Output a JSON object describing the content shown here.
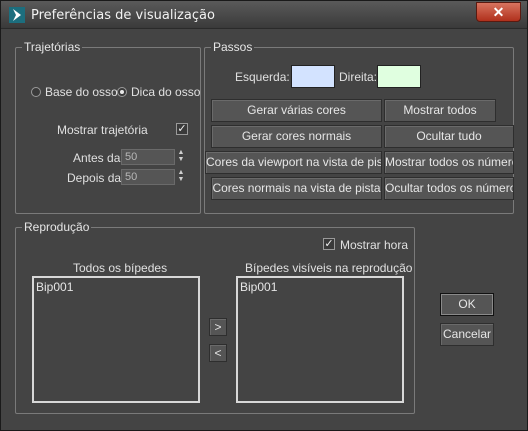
{
  "window": {
    "title": "Preferências de visualização",
    "close_label": "✕"
  },
  "trajetorias": {
    "title": "Trajetórias",
    "radio_base": "Base do osso",
    "radio_dica": "Dica do osso",
    "mostrar_trajetoria": "Mostrar trajetória",
    "antes_label": "Antes da",
    "antes_value": "50",
    "depois_label": "Depois da",
    "depois_value": "50"
  },
  "passos": {
    "title": "Passos",
    "esquerda_label": "Esquerda:",
    "direita_label": "Direita:",
    "colors": {
      "esquerda": "#d3e3ff",
      "direita": "#e0ffe0"
    },
    "buttons": {
      "gerar_varias": "Gerar várias cores",
      "mostrar_todos": "Mostrar todos",
      "gerar_normais": "Gerar cores normais",
      "ocultar_tudo": "Ocultar tudo",
      "cores_viewport": "Cores da viewport na vista de pista",
      "mostrar_numeros": "Mostrar todos os números",
      "cores_normais_pista": "Cores normais na vista de pista",
      "ocultar_numeros": "Ocultar todos os números"
    }
  },
  "reproducao": {
    "title": "Reprodução",
    "mostrar_hora": "Mostrar hora",
    "todos_label": "Todos os bípedes",
    "todos_items": [
      "Bip001"
    ],
    "visiveis_label": "Bípedes visíveis na reprodução",
    "visiveis_items": [
      "Bip001"
    ],
    "add_label": ">",
    "remove_label": "<"
  },
  "dialog": {
    "ok": "OK",
    "cancel": "Cancelar"
  }
}
